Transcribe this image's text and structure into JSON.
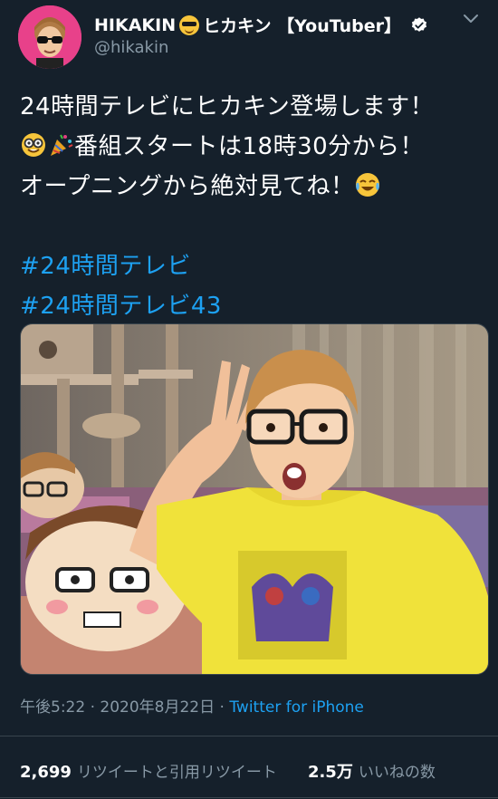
{
  "author": {
    "display_name": "HIKAKIN",
    "display_name_suffix": "ヒカキン 【YouTuber】",
    "handle": "@hikakin",
    "verified": true
  },
  "tweet": {
    "line1": "24時間テレビにヒカキン登場します！",
    "line2_text": "番組スタートは18時30分から！",
    "line3_text": "オープニングから絶対見てね！",
    "hashtags": [
      "#24時間テレビ",
      "#24時間テレビ43"
    ]
  },
  "meta": {
    "time": "午後5:22",
    "separator": " · ",
    "date": "2020年8月22日",
    "source": "Twitter for iPhone"
  },
  "stats": {
    "retweets": "2,699",
    "retweets_label": "リツイートと引用リツイート",
    "likes": "2.5万",
    "likes_label": "いいねの数"
  },
  "icons": {
    "verified": "verified-badge-icon",
    "more": "chevron-down-icon",
    "emoji_sunglasses": "sunglasses-face-icon",
    "emoji_nerd": "nerd-face-icon",
    "emoji_party": "party-popper-icon",
    "emoji_joy": "tears-of-joy-icon"
  },
  "colors": {
    "background": "#15202b",
    "accent": "#1da1f2",
    "secondary_text": "#8899a6",
    "divider": "#38444d"
  }
}
